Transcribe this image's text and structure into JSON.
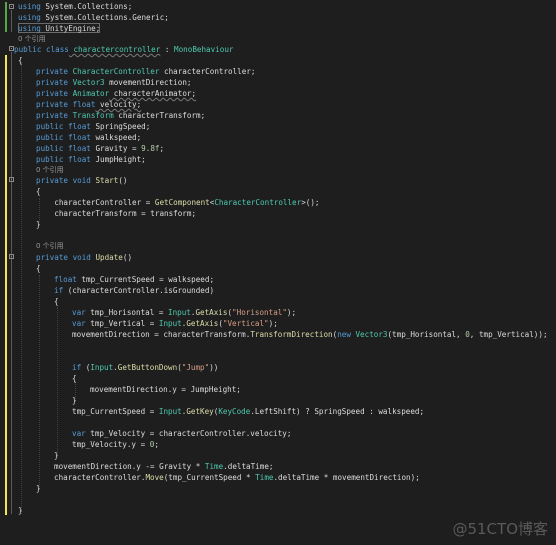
{
  "codelens": {
    "refs_class": "0 个引用",
    "refs_start": "0 个引用",
    "refs_update": "0 个引用"
  },
  "code": {
    "using1": {
      "kw": "using",
      "rest": " System.Collections;"
    },
    "using2": {
      "kw": "using",
      "rest": " System.Collections.Generic;"
    },
    "using3": {
      "kw": "using",
      "rest": " UnityEngine;"
    },
    "class_decl": {
      "kw1": "public",
      "kw2": " class",
      "name": " charactercontroller",
      "colon": " : ",
      "base": "MonoBehaviour"
    },
    "brace_open": "{",
    "f1": {
      "kw": "private",
      "type": " CharacterController",
      "name": " characterController;"
    },
    "f2": {
      "kw": "private",
      "type": " Vector3",
      "name": " movementDirection;"
    },
    "f3": {
      "kw": "private",
      "type": " Animator",
      "name": " characterAnimator;"
    },
    "f4": {
      "kw": "private",
      "type": " float",
      "name": " velocity;"
    },
    "f5": {
      "kw": "private",
      "type": " Transform",
      "name": " characterTransform;"
    },
    "f6": {
      "kw": "public",
      "type": " float",
      "name": " SpringSpeed;"
    },
    "f7": {
      "kw": "public",
      "type": " float",
      "name": " walkspeed;"
    },
    "f8": {
      "kw": "public",
      "type": " float",
      "name": " Gravity = ",
      "num": "9.8f",
      "end": ";"
    },
    "f9": {
      "kw": "public",
      "type": " float",
      "name": " JumpHeight;"
    },
    "start_decl": {
      "kw1": "private",
      "kw2": " void",
      "name": " Start",
      "end": "()"
    },
    "start_b1": "    characterController = ",
    "start_b2": "GetComponent",
    "start_b3": "<",
    "start_b4": "CharacterController",
    "start_b5": ">();",
    "start_c": "    characterTransform = transform;",
    "update_decl": {
      "kw1": "private",
      "kw2": " void",
      "name": " Update",
      "end": "()"
    },
    "u1": {
      "kw": "float",
      "rest": " tmp_CurrentSpeed = walkspeed;"
    },
    "u2": {
      "kw": "if",
      "rest": " (characterController.isGrounded)"
    },
    "u3a": {
      "kw": "var",
      "rest": " tmp_Horisontal = ",
      "ty": "Input",
      "dot": ".",
      "me": "GetAxis",
      "p": "(",
      "st": "\"Horisontal\"",
      "end": ");"
    },
    "u3b": {
      "kw": "var",
      "rest": " tmp_Vertical = ",
      "ty": "Input",
      "dot": ".",
      "me": "GetAxis",
      "p": "(",
      "st": "\"Vertical\"",
      "end": ");"
    },
    "u3c": {
      "a": "movementDirection = characterTransform.",
      "me": "TransformDirection",
      "b": "(",
      "kw": "new",
      "ty": " Vector3",
      "c": "(tmp_Horisontal, ",
      "num": "0",
      "d": ", tmp_Vertical));"
    },
    "u4": {
      "kw": "if",
      "a": " (",
      "ty": "Input",
      "dot": ".",
      "me": "GetButtonDown",
      "p": "(",
      "st": "\"Jump\"",
      "end": "))"
    },
    "u4b": "movementDirection.y = JumpHeight;",
    "u5": {
      "a": "tmp_CurrentSpeed = ",
      "ty": "Input",
      "dot": ".",
      "me": "GetKey",
      "b": "(",
      "ty2": "KeyCode",
      "c": ".LeftShift) ? SpringSpeed : walkspeed;"
    },
    "u6": {
      "kw": "var",
      "rest": " tmp_Velocity = characterController.velocity;"
    },
    "u7": {
      "a": "tmp_Velocity.y = ",
      "num": "0",
      "end": ";"
    },
    "u8": {
      "a": "movementDirection.y -= Gravity * ",
      "ty": "Time",
      "b": ".deltaTime;"
    },
    "u9": {
      "a": "characterController.",
      "me": "Move",
      "b": "(tmp_CurrentSpeed * ",
      "ty": "Time",
      "c": ".deltaTime * movementDirection);"
    },
    "close": "}"
  },
  "watermark": "@51CTO博客"
}
